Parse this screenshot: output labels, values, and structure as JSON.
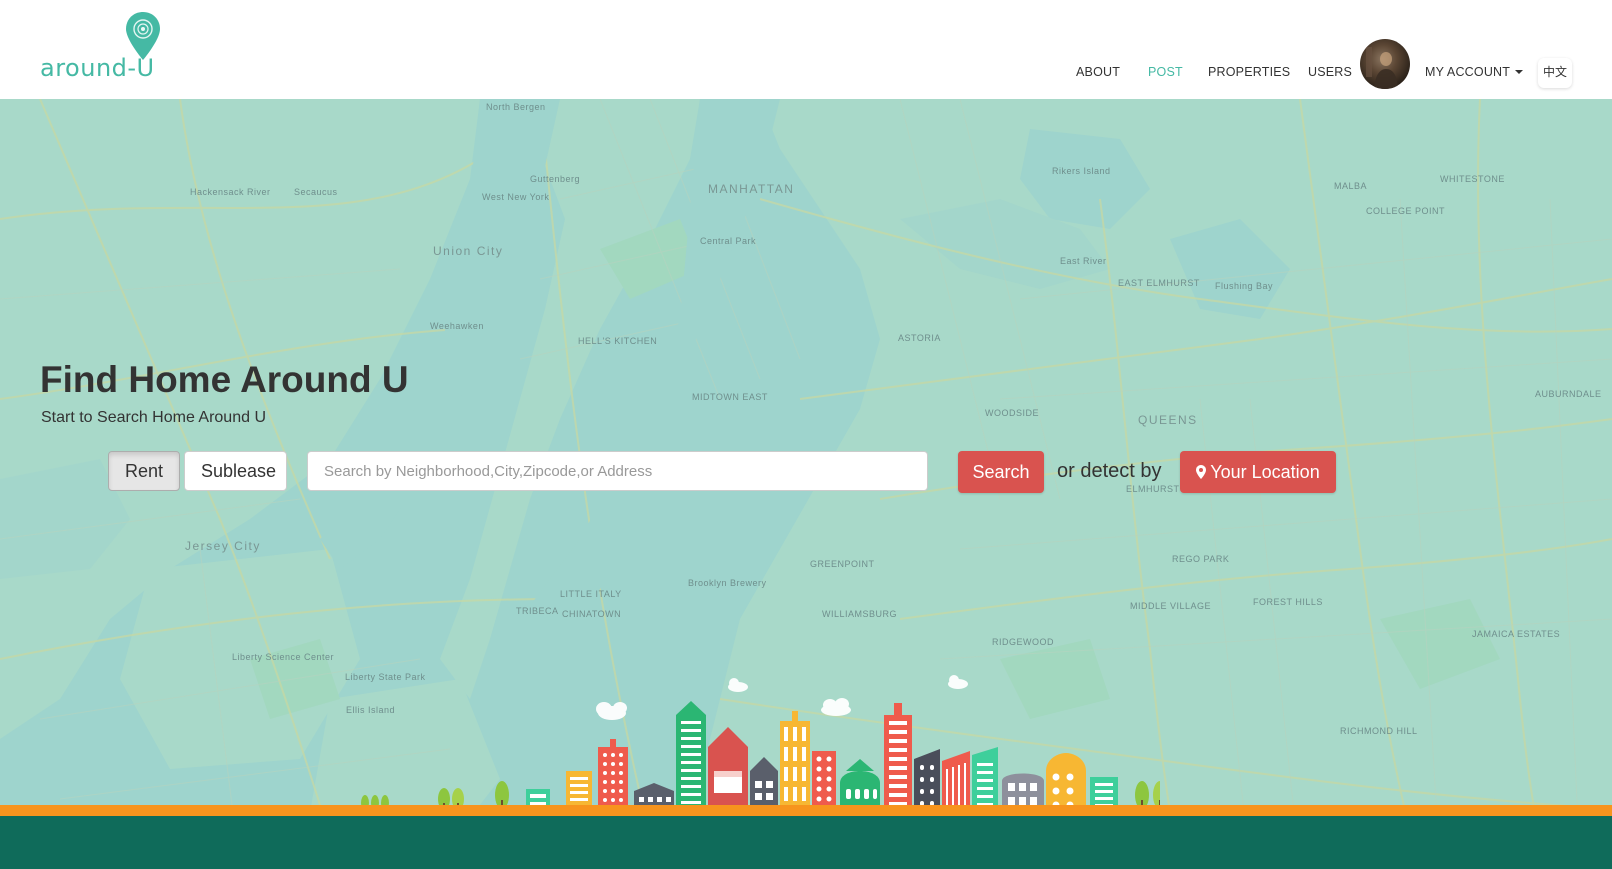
{
  "brand": {
    "logo_text": "around-U",
    "logo_color": "#45b9a4"
  },
  "nav": {
    "items": [
      {
        "label": "ABOUT",
        "active": false
      },
      {
        "label": "POST",
        "active": true
      },
      {
        "label": "PROPERTIES",
        "active": false
      },
      {
        "label": "USERS",
        "active": false
      }
    ],
    "account_label": "MY ACCOUNT",
    "language_label": "中文"
  },
  "hero": {
    "title": "Find Home Around U",
    "subtitle": "Start to Search Home Around U",
    "toggle": {
      "rent_label": "Rent",
      "sublease_label": "Sublease",
      "selected": "Rent"
    },
    "search": {
      "placeholder": "Search by Neighborhood,City,Zipcode,or Address",
      "value": "",
      "button_label": "Search"
    },
    "detect_text": "or detect by",
    "location_button_label": "Your Location"
  },
  "map_labels": [
    "North Bergen",
    "MANHATTAN",
    "Union City",
    "Secaucus",
    "Hackensack River",
    "West New York",
    "Guttenberg",
    "Weehawken",
    "Rikers Island",
    "QUEENS",
    "Jersey City",
    "East River",
    "Flushing Bay",
    "Central Park",
    "HELL'S KITCHEN",
    "MIDTOWN EAST",
    "ASTORIA",
    "WOODSIDE",
    "ELMHURST",
    "EAST ELMHURST",
    "WHITESTONE",
    "COLLEGE POINT",
    "MALBA",
    "AUBURNDALE",
    "GREENPOINT",
    "WILLIAMSBURG",
    "Brooklyn Brewery",
    "TRIBECA",
    "CHINATOWN",
    "LITTLE ITALY",
    "Liberty State Park",
    "Ellis Island",
    "Liberty Science Center",
    "MIDDLE VILLAGE",
    "RIDGEWOOD",
    "FOREST HILLS",
    "REGO PARK",
    "JAMAICA ESTATES",
    "RICHMOND HILL"
  ],
  "colors": {
    "accent": "#45b9a4",
    "danger": "#d9534f",
    "map_water": "#9ed4cd",
    "map_land": "#a9dac9",
    "ground_orange": "#f7941d",
    "ground_green": "#0f6b5a"
  },
  "icons": {
    "logo": "map-pin-icon",
    "location": "map-marker-icon",
    "account_caret": "caret-down-icon"
  }
}
